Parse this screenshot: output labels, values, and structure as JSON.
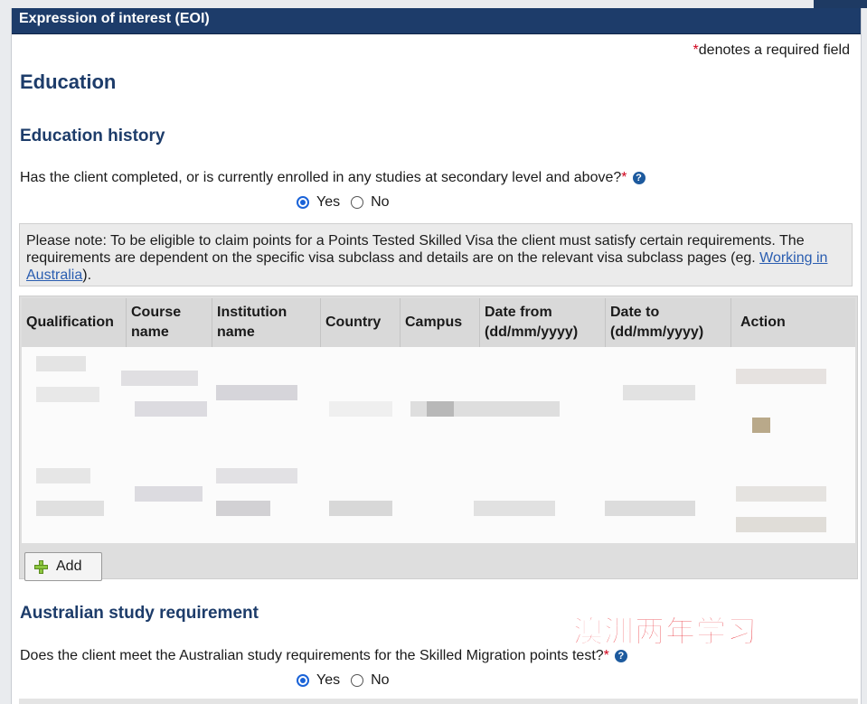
{
  "header": {
    "title": "Expression of interest (EOI)"
  },
  "required_note": {
    "star": "*",
    "text": "denotes a required field"
  },
  "education": {
    "title": "Education"
  },
  "education_history": {
    "title": "Education history",
    "question": "Has the client completed, or is currently enrolled in any studies at secondary level and above?",
    "required_star": "*",
    "help_icon": "?",
    "options": [
      {
        "label": "Yes",
        "checked": true
      },
      {
        "label": "No",
        "checked": false
      }
    ],
    "note_pre": "Please note: To be eligible to claim points for a Points Tested Skilled Visa the client must satisfy certain requirements. The requirements are dependent on the specific visa subclass and details are on the relevant visa subclass pages (eg. ",
    "note_link": "Working in Australia",
    "note_post": ").",
    "table": {
      "columns": [
        "Qualification",
        "Course name",
        "Institution name",
        "Country",
        "Campus",
        "Date from (dd/mm/yyyy)",
        "Date to (dd/mm/yyyy)",
        "Action"
      ],
      "rows_obscured": true
    },
    "add_button": {
      "label": "Add",
      "icon": "plus-icon"
    }
  },
  "australian_study": {
    "title": "Australian study requirement",
    "question": "Does the client meet the Australian study requirements for the Skilled Migration points test?",
    "required_star": "*",
    "help_icon": "?",
    "options": [
      {
        "label": "Yes",
        "checked": true
      },
      {
        "label": "No",
        "checked": false
      }
    ]
  },
  "watermark": {
    "text": "澳洲两年学习",
    "color": "#e8222b"
  },
  "colors": {
    "header_bg": "#1d3c6a",
    "heading": "#1d3c6a",
    "radio_accent": "#1a63d8",
    "link": "#2a5db0"
  }
}
